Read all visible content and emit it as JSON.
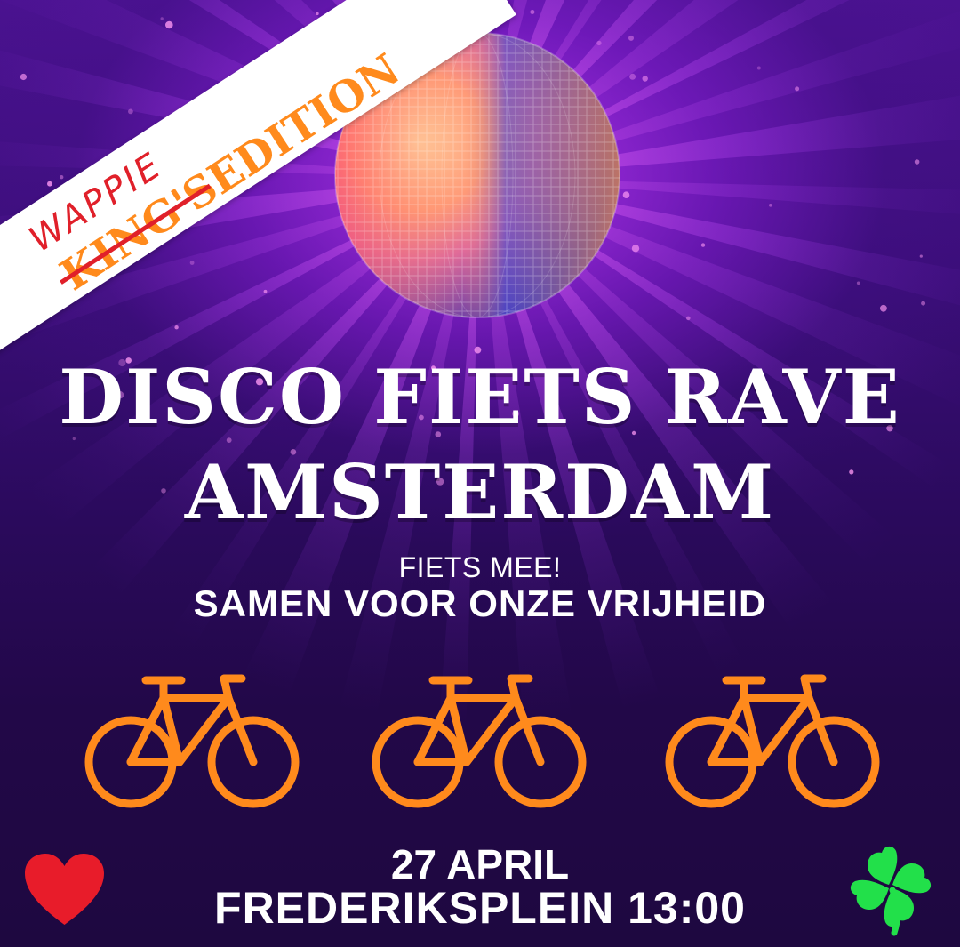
{
  "banner": {
    "handwritten": "WAPPIE",
    "struck": "KING'S",
    "suffix": "EDITION",
    "colors": {
      "handwritten": "#e0202a",
      "struck": "#ff8a1c",
      "suffix": "#ff8a1c",
      "strike_line": "#e0202a"
    }
  },
  "title": {
    "line1": "DISCO FIETS RAVE",
    "line2": "AMSTERDAM"
  },
  "subtitle": {
    "line1": "FIETS MEE!",
    "line2": "SAMEN VOOR ONZE VRIJHEID"
  },
  "event": {
    "date": "27 APRIL",
    "location_time": "FREDERIKSPLEIN 13:00"
  },
  "icons": {
    "bikes": [
      "bicycle-icon",
      "bicycle-icon",
      "bicycle-icon"
    ],
    "left": "heart-icon",
    "right": "four-leaf-clover-icon",
    "centerpiece": "disco-ball-icon"
  },
  "colors": {
    "background": "#1e0840",
    "glow": "#c43aff",
    "bike": "#ff8a1c",
    "heart": "#e81c2a",
    "clover": "#22e04a",
    "text": "#ffffff"
  }
}
